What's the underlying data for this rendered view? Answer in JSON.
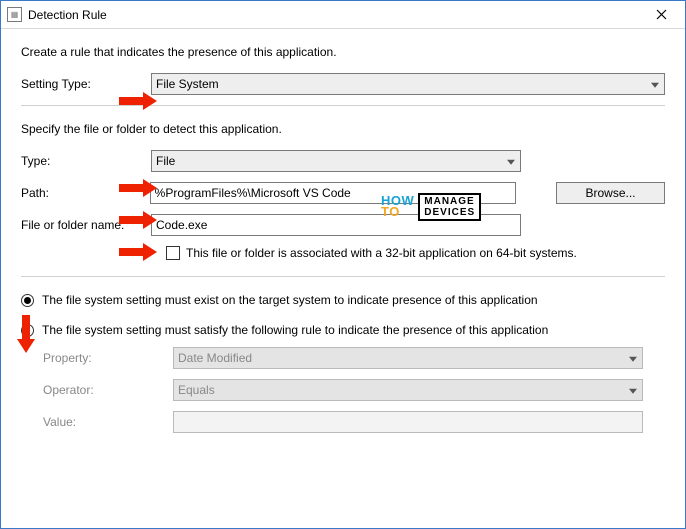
{
  "window": {
    "title": "Detection Rule"
  },
  "intro1": "Create a rule that indicates the presence of this application.",
  "intro2": "Specify the file or folder to detect this application.",
  "labels": {
    "settingType": "Setting Type:",
    "type": "Type:",
    "path": "Path:",
    "fileName": "File or folder name:",
    "browse": "Browse...",
    "assoc32": "This file or folder is associated with a 32-bit application on 64-bit systems.",
    "radio1": "The file system setting must exist on the target system to indicate presence of this application",
    "radio2": "The file system setting must satisfy the following rule to indicate the presence of this application",
    "property": "Property:",
    "operator": "Operator:",
    "value": "Value:"
  },
  "values": {
    "settingType": "File System",
    "type": "File",
    "path": "%ProgramFiles%\\Microsoft VS Code",
    "fileName": "Code.exe",
    "property": "Date Modified",
    "operator": "Equals",
    "value": ""
  },
  "watermark": {
    "how": "HOW",
    "to": "TO",
    "line1": "MANAGE",
    "line2": "DEVICES"
  }
}
